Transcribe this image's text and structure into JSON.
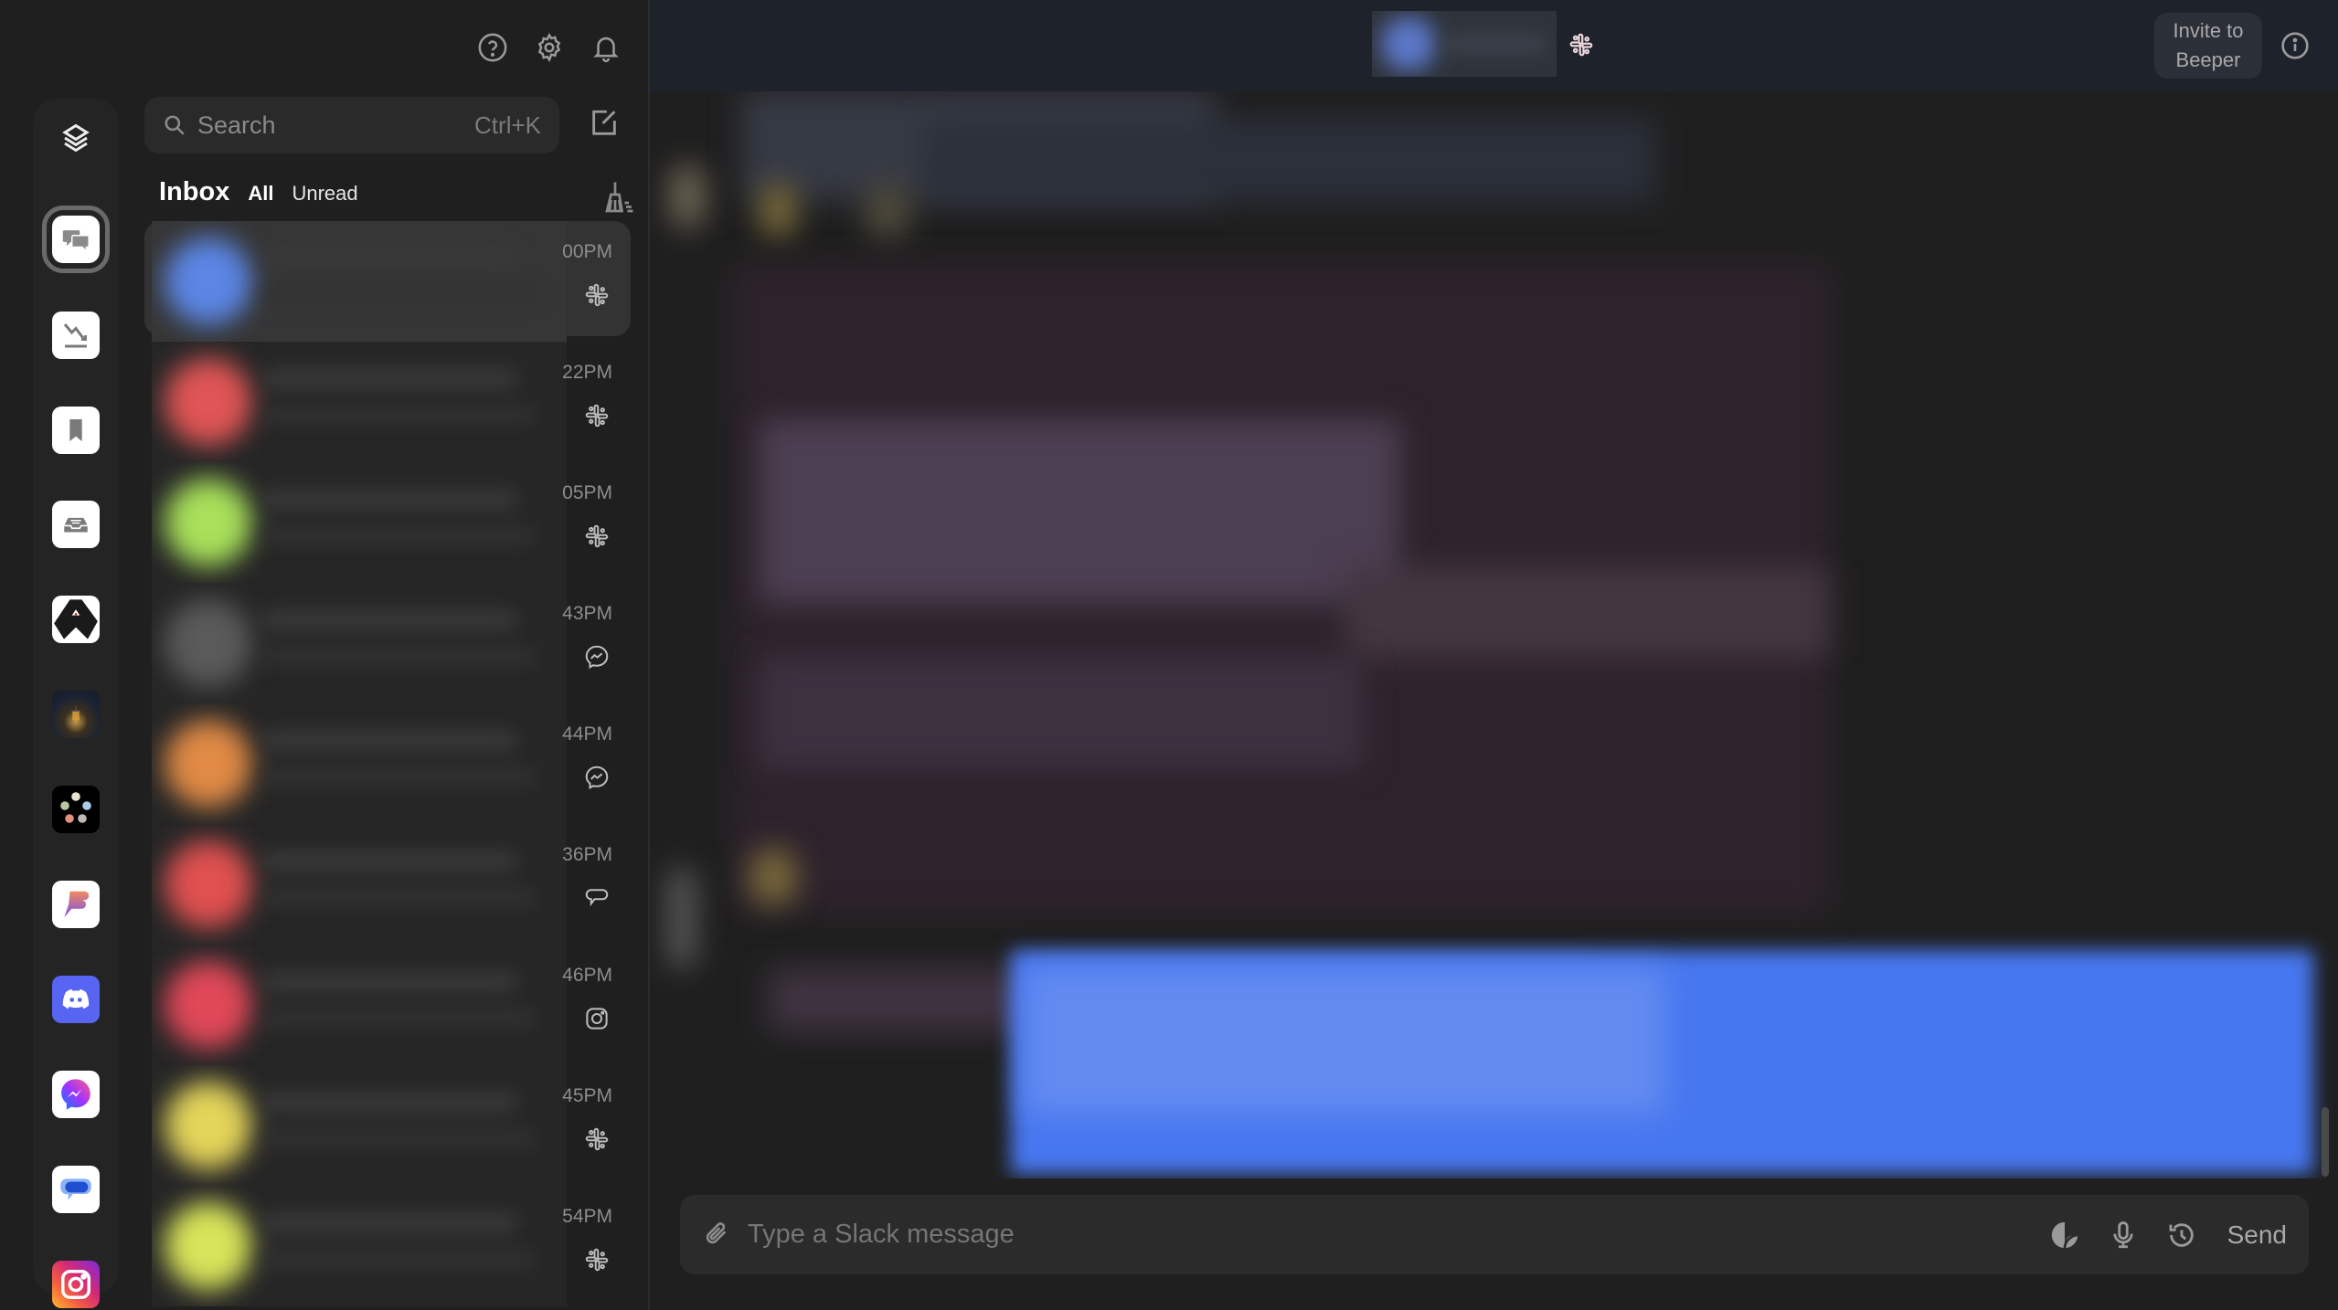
{
  "top_icons": {
    "help": "help-icon",
    "settings": "gear-icon",
    "notifications": "bell-icon"
  },
  "rail": {
    "items": [
      {
        "name": "all-networks",
        "icon": "layers-icon"
      },
      {
        "name": "beeper-chats",
        "icon": "chat-bubbles-icon",
        "active": true
      },
      {
        "name": "low-priority",
        "icon": "trend-down-icon"
      },
      {
        "name": "bookmarks",
        "icon": "bookmark-icon"
      },
      {
        "name": "archive",
        "icon": "inbox-tray-icon"
      },
      {
        "name": "android-police",
        "icon": "android-police-icon"
      },
      {
        "name": "dark-souls-space",
        "icon": "lantern-icon"
      },
      {
        "name": "mtg-space",
        "icon": "mana-symbols-icon"
      },
      {
        "name": "beeper",
        "icon": "beeper-logo-icon"
      },
      {
        "name": "discord",
        "icon": "discord-icon"
      },
      {
        "name": "messenger",
        "icon": "messenger-icon"
      },
      {
        "name": "google-messages",
        "icon": "google-messages-icon"
      },
      {
        "name": "instagram",
        "icon": "instagram-icon"
      }
    ]
  },
  "search": {
    "placeholder": "Search",
    "shortcut": "Ctrl+K"
  },
  "inbox": {
    "title": "Inbox",
    "tabs": [
      {
        "label": "All",
        "selected": true
      },
      {
        "label": "Unread",
        "selected": false
      }
    ]
  },
  "chats": [
    {
      "time": "00PM",
      "network": "slack",
      "avatar_color": "#5b86e5",
      "selected": true
    },
    {
      "time": "22PM",
      "network": "slack",
      "avatar_color": "#e05555"
    },
    {
      "time": "05PM",
      "network": "slack",
      "avatar_color": "#a8e05a"
    },
    {
      "time": "43PM",
      "network": "messenger",
      "avatar_color": "#5a5a5a"
    },
    {
      "time": "44PM",
      "network": "messenger",
      "avatar_color": "#e08a45"
    },
    {
      "time": "36PM",
      "network": "google-messages",
      "avatar_color": "#e05050"
    },
    {
      "time": "46PM",
      "network": "instagram",
      "avatar_color": "#e04858"
    },
    {
      "time": "45PM",
      "network": "slack",
      "avatar_color": "#e3d45a"
    },
    {
      "time": "54PM",
      "network": "slack",
      "avatar_color": "#d8e45a"
    }
  ],
  "header": {
    "network": "slack",
    "invite_label": "Invite to Beeper"
  },
  "composer": {
    "placeholder": "Type a Slack message",
    "send_label": "Send"
  },
  "colors": {
    "outgoing_bubble": "#4777f0",
    "incoming_bubble": "#2e232c",
    "header_bg": "#1e222b"
  }
}
